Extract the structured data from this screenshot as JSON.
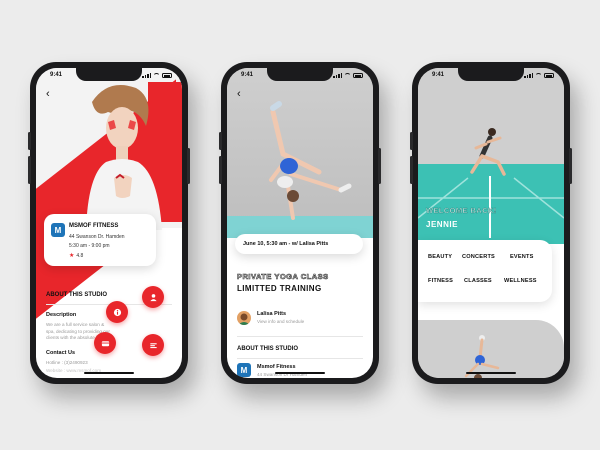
{
  "status_time": "9:41",
  "colors": {
    "accent": "#e8262b",
    "teal": "#3cc1b4",
    "brand_blue": "#1e74b8"
  },
  "phone1": {
    "back_icon": "chevron-left-icon",
    "studio": {
      "logo_letter": "M",
      "name": "MSMOF FITNESS",
      "address": "44 Swanson Dr. Hamden",
      "hours": "5:30 am - 9:00 pm",
      "rating": "4.8"
    },
    "about_title": "ABOUT THIS STUDIO",
    "description_title": "Description",
    "description_text": "We are a full service salon & spa, dedicating to providing our clients with the absolute best",
    "contact_title": "Contact Us",
    "hotline": "Hotline : (3)2490923",
    "website": "Website : www.msmof.com",
    "fab_icons": [
      "user-icon",
      "info-icon",
      "list-icon",
      "card-icon"
    ]
  },
  "phone2": {
    "back_icon": "chevron-left-icon",
    "date_line": "June 10, 5:30 am - w/ Lalisa Pitts",
    "class_title_1": "PRIVATE YOGA CLASS",
    "class_title_2": "LIMITTED TRAINING",
    "instructor_name": "Lalisa Pitts",
    "instructor_sub": "View info and schedule",
    "about_title": "ABOUT THIS STUDIO",
    "studio_name": "Msmof Fitness",
    "studio_addr": "44 Swanson Dr Hamden"
  },
  "phone3": {
    "welcome": "WELCOME BACK!",
    "user_name": "JENNIE",
    "categories": [
      "BEAUTY",
      "CONCERTS",
      "EVENTS",
      "FITNESS",
      "CLASSES",
      "WELLNESS"
    ]
  }
}
